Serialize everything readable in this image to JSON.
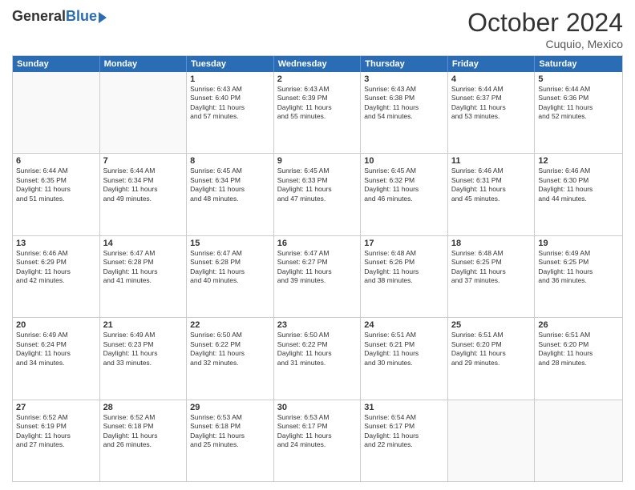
{
  "logo": {
    "general": "General",
    "blue": "Blue"
  },
  "title": "October 2024",
  "location": "Cuquio, Mexico",
  "days": [
    "Sunday",
    "Monday",
    "Tuesday",
    "Wednesday",
    "Thursday",
    "Friday",
    "Saturday"
  ],
  "rows": [
    [
      {
        "day": "",
        "lines": []
      },
      {
        "day": "",
        "lines": []
      },
      {
        "day": "1",
        "lines": [
          "Sunrise: 6:43 AM",
          "Sunset: 6:40 PM",
          "Daylight: 11 hours",
          "and 57 minutes."
        ]
      },
      {
        "day": "2",
        "lines": [
          "Sunrise: 6:43 AM",
          "Sunset: 6:39 PM",
          "Daylight: 11 hours",
          "and 55 minutes."
        ]
      },
      {
        "day": "3",
        "lines": [
          "Sunrise: 6:43 AM",
          "Sunset: 6:38 PM",
          "Daylight: 11 hours",
          "and 54 minutes."
        ]
      },
      {
        "day": "4",
        "lines": [
          "Sunrise: 6:44 AM",
          "Sunset: 6:37 PM",
          "Daylight: 11 hours",
          "and 53 minutes."
        ]
      },
      {
        "day": "5",
        "lines": [
          "Sunrise: 6:44 AM",
          "Sunset: 6:36 PM",
          "Daylight: 11 hours",
          "and 52 minutes."
        ]
      }
    ],
    [
      {
        "day": "6",
        "lines": [
          "Sunrise: 6:44 AM",
          "Sunset: 6:35 PM",
          "Daylight: 11 hours",
          "and 51 minutes."
        ]
      },
      {
        "day": "7",
        "lines": [
          "Sunrise: 6:44 AM",
          "Sunset: 6:34 PM",
          "Daylight: 11 hours",
          "and 49 minutes."
        ]
      },
      {
        "day": "8",
        "lines": [
          "Sunrise: 6:45 AM",
          "Sunset: 6:34 PM",
          "Daylight: 11 hours",
          "and 48 minutes."
        ]
      },
      {
        "day": "9",
        "lines": [
          "Sunrise: 6:45 AM",
          "Sunset: 6:33 PM",
          "Daylight: 11 hours",
          "and 47 minutes."
        ]
      },
      {
        "day": "10",
        "lines": [
          "Sunrise: 6:45 AM",
          "Sunset: 6:32 PM",
          "Daylight: 11 hours",
          "and 46 minutes."
        ]
      },
      {
        "day": "11",
        "lines": [
          "Sunrise: 6:46 AM",
          "Sunset: 6:31 PM",
          "Daylight: 11 hours",
          "and 45 minutes."
        ]
      },
      {
        "day": "12",
        "lines": [
          "Sunrise: 6:46 AM",
          "Sunset: 6:30 PM",
          "Daylight: 11 hours",
          "and 44 minutes."
        ]
      }
    ],
    [
      {
        "day": "13",
        "lines": [
          "Sunrise: 6:46 AM",
          "Sunset: 6:29 PM",
          "Daylight: 11 hours",
          "and 42 minutes."
        ]
      },
      {
        "day": "14",
        "lines": [
          "Sunrise: 6:47 AM",
          "Sunset: 6:28 PM",
          "Daylight: 11 hours",
          "and 41 minutes."
        ]
      },
      {
        "day": "15",
        "lines": [
          "Sunrise: 6:47 AM",
          "Sunset: 6:28 PM",
          "Daylight: 11 hours",
          "and 40 minutes."
        ]
      },
      {
        "day": "16",
        "lines": [
          "Sunrise: 6:47 AM",
          "Sunset: 6:27 PM",
          "Daylight: 11 hours",
          "and 39 minutes."
        ]
      },
      {
        "day": "17",
        "lines": [
          "Sunrise: 6:48 AM",
          "Sunset: 6:26 PM",
          "Daylight: 11 hours",
          "and 38 minutes."
        ]
      },
      {
        "day": "18",
        "lines": [
          "Sunrise: 6:48 AM",
          "Sunset: 6:25 PM",
          "Daylight: 11 hours",
          "and 37 minutes."
        ]
      },
      {
        "day": "19",
        "lines": [
          "Sunrise: 6:49 AM",
          "Sunset: 6:25 PM",
          "Daylight: 11 hours",
          "and 36 minutes."
        ]
      }
    ],
    [
      {
        "day": "20",
        "lines": [
          "Sunrise: 6:49 AM",
          "Sunset: 6:24 PM",
          "Daylight: 11 hours",
          "and 34 minutes."
        ]
      },
      {
        "day": "21",
        "lines": [
          "Sunrise: 6:49 AM",
          "Sunset: 6:23 PM",
          "Daylight: 11 hours",
          "and 33 minutes."
        ]
      },
      {
        "day": "22",
        "lines": [
          "Sunrise: 6:50 AM",
          "Sunset: 6:22 PM",
          "Daylight: 11 hours",
          "and 32 minutes."
        ]
      },
      {
        "day": "23",
        "lines": [
          "Sunrise: 6:50 AM",
          "Sunset: 6:22 PM",
          "Daylight: 11 hours",
          "and 31 minutes."
        ]
      },
      {
        "day": "24",
        "lines": [
          "Sunrise: 6:51 AM",
          "Sunset: 6:21 PM",
          "Daylight: 11 hours",
          "and 30 minutes."
        ]
      },
      {
        "day": "25",
        "lines": [
          "Sunrise: 6:51 AM",
          "Sunset: 6:20 PM",
          "Daylight: 11 hours",
          "and 29 minutes."
        ]
      },
      {
        "day": "26",
        "lines": [
          "Sunrise: 6:51 AM",
          "Sunset: 6:20 PM",
          "Daylight: 11 hours",
          "and 28 minutes."
        ]
      }
    ],
    [
      {
        "day": "27",
        "lines": [
          "Sunrise: 6:52 AM",
          "Sunset: 6:19 PM",
          "Daylight: 11 hours",
          "and 27 minutes."
        ]
      },
      {
        "day": "28",
        "lines": [
          "Sunrise: 6:52 AM",
          "Sunset: 6:18 PM",
          "Daylight: 11 hours",
          "and 26 minutes."
        ]
      },
      {
        "day": "29",
        "lines": [
          "Sunrise: 6:53 AM",
          "Sunset: 6:18 PM",
          "Daylight: 11 hours",
          "and 25 minutes."
        ]
      },
      {
        "day": "30",
        "lines": [
          "Sunrise: 6:53 AM",
          "Sunset: 6:17 PM",
          "Daylight: 11 hours",
          "and 24 minutes."
        ]
      },
      {
        "day": "31",
        "lines": [
          "Sunrise: 6:54 AM",
          "Sunset: 6:17 PM",
          "Daylight: 11 hours",
          "and 22 minutes."
        ]
      },
      {
        "day": "",
        "lines": []
      },
      {
        "day": "",
        "lines": []
      }
    ]
  ]
}
